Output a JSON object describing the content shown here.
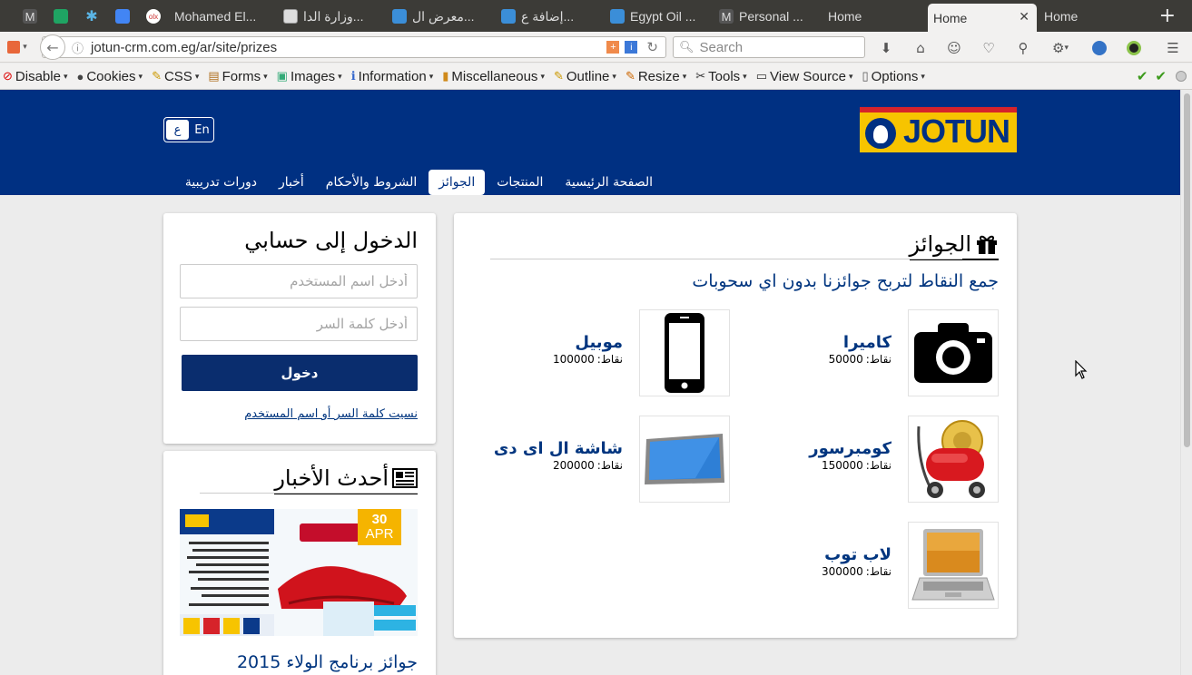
{
  "browser": {
    "tabs": [
      {
        "label": "",
        "icon": "gmail-icon",
        "pinned": true
      },
      {
        "label": "",
        "icon": "sheets-icon",
        "pinned": true
      },
      {
        "label": "",
        "icon": "snowflake-icon",
        "pinned": true
      },
      {
        "label": "",
        "icon": "docs-icon",
        "pinned": true
      },
      {
        "label": "",
        "icon": "olx-icon",
        "pinned": true
      },
      {
        "label": "Mohamed El...",
        "icon": "gmail-icon"
      },
      {
        "label": "وزارة الدا...",
        "icon": "document-icon"
      },
      {
        "label": "معرض ال...",
        "icon": "blue-square-icon"
      },
      {
        "label": "إضافة ع...",
        "icon": "blue-square-icon"
      },
      {
        "label": "Egypt Oil ...",
        "icon": "blue-square-icon"
      },
      {
        "label": "Personal ...",
        "icon": "gmail-icon"
      },
      {
        "label": "Home",
        "icon": ""
      },
      {
        "label": "Home",
        "icon": "",
        "active": true
      },
      {
        "label": "Home",
        "icon": ""
      }
    ],
    "url": "jotun-crm.com.eg/ar/site/prizes",
    "search_placeholder": "Search",
    "devtools": [
      {
        "label": "Disable",
        "icon": "⊘"
      },
      {
        "label": "Cookies",
        "icon": "●"
      },
      {
        "label": "CSS",
        "icon": "✎"
      },
      {
        "label": "Forms",
        "icon": "▤"
      },
      {
        "label": "Images",
        "icon": "▣"
      },
      {
        "label": "Information",
        "icon": "ℹ"
      },
      {
        "label": "Miscellaneous",
        "icon": "▮"
      },
      {
        "label": "Outline",
        "icon": "✎"
      },
      {
        "label": "Resize",
        "icon": "✎"
      },
      {
        "label": "Tools",
        "icon": "✂"
      },
      {
        "label": "View Source",
        "icon": "▭"
      },
      {
        "label": "Options",
        "icon": "▯"
      }
    ]
  },
  "site": {
    "lang": {
      "ar": "ع",
      "en": "En"
    },
    "logo_text": "JOTUN",
    "nav": [
      {
        "label": "الصفحة الرئيسية"
      },
      {
        "label": "المنتجات"
      },
      {
        "label": "الجوائز",
        "active": true
      },
      {
        "label": "الشروط والأحكام"
      },
      {
        "label": "أخبار"
      },
      {
        "label": "دورات تدريبية"
      }
    ],
    "prizes": {
      "title": "الجوائز",
      "subtitle": "جمع النقاط لتربح جوائزنا بدون اي سحوبات",
      "points_label": "نقاط:",
      "items": [
        {
          "name": "كاميرا",
          "points": "50000",
          "icon": "camera-icon"
        },
        {
          "name": "موبيل",
          "points": "100000",
          "icon": "mobile-phone-icon"
        },
        {
          "name": "كومبرسور",
          "points": "150000",
          "icon": "compressor-icon"
        },
        {
          "name": "شاشة ال اى دى",
          "points": "200000",
          "icon": "led-screen-icon"
        },
        {
          "name": "لاب توب",
          "points": "300000",
          "icon": "laptop-icon"
        }
      ]
    },
    "login": {
      "title": "الدخول إلى حسابي",
      "username_placeholder": "أدخل اسم المستخدم",
      "password_placeholder": "أدخل كلمة السر",
      "submit": "دخول",
      "forgot": "نسيت كلمة السر أو اسم المستخدم"
    },
    "news": {
      "title": "أحدث الأخبار",
      "date_day": "30",
      "date_month": "APR",
      "headline": "جوائز برنامج الولاء 2015"
    }
  },
  "colors": {
    "brand_blue": "#003082",
    "brand_yellow": "#f7c400",
    "brand_red": "#d6232a",
    "link_blue": "#00357f",
    "button_blue": "#0a2d6e"
  }
}
